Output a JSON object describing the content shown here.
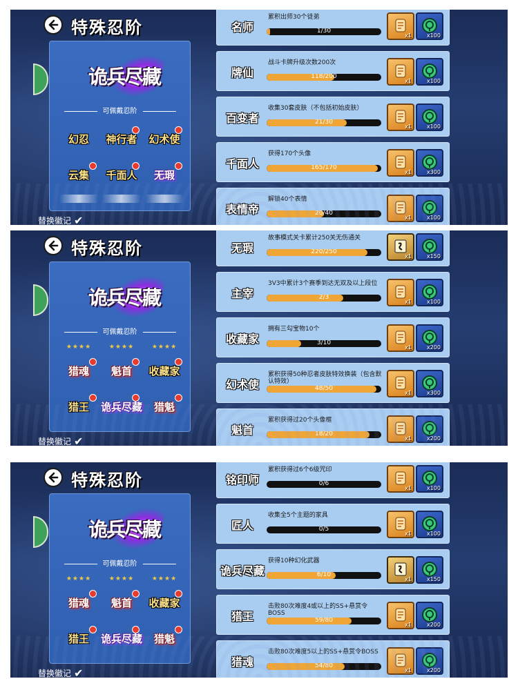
{
  "header": {
    "title": "特殊忍阶"
  },
  "left_card": {
    "selected_title": "诡兵尽藏",
    "wearable_label": "可佩戴忍阶",
    "replace_label": "替换徽记"
  },
  "panels": [
    {
      "badges_rows": [
        [
          {
            "text": "幻忍",
            "style": "gold",
            "dot": false
          },
          {
            "text": "神行者",
            "style": "gold",
            "dot": true
          },
          {
            "text": "幻术使",
            "style": "gold",
            "dot": true
          }
        ],
        [
          {
            "text": "云集",
            "style": "gold",
            "dot": true
          },
          {
            "text": "千面人",
            "style": "gold",
            "dot": true
          },
          {
            "text": "无瑕",
            "style": "purple",
            "dot": true
          }
        ]
      ],
      "partial_top": false,
      "partial_bottom": true,
      "achievements": [
        {
          "badge": "名师",
          "desc": "累积出师30个徒弟",
          "progress": "1/30",
          "pct": 0.033,
          "reward1": {
            "type": "scroll",
            "qty": "x1"
          },
          "reward2": {
            "type": "coin",
            "qty": "x100"
          }
        },
        {
          "badge": "牌仙",
          "desc": "战斗卡牌升级次数200次",
          "progress": "118/200",
          "pct": 0.59,
          "reward1": {
            "type": "scroll",
            "qty": "x1"
          },
          "reward2": {
            "type": "coin",
            "qty": "x100"
          }
        },
        {
          "badge": "百变者",
          "desc": "收集30套皮肤（不包括初始皮肤）",
          "progress": "21/30",
          "pct": 0.7,
          "reward1": {
            "type": "scroll",
            "qty": "x1"
          },
          "reward2": {
            "type": "coin",
            "qty": "x100"
          }
        },
        {
          "badge": "千面人",
          "desc": "获得170个头像",
          "progress": "165/170",
          "pct": 0.97,
          "reward1": {
            "type": "scroll",
            "qty": "x1"
          },
          "reward2": {
            "type": "coin",
            "qty": "x300"
          }
        },
        {
          "badge": "表情帝",
          "desc": "解锁40个表情",
          "progress": "20/40",
          "pct": 0.5,
          "reward1": {
            "type": "scroll",
            "qty": "x1"
          },
          "reward2": {
            "type": "coin",
            "qty": "x100"
          }
        }
      ]
    },
    {
      "badges_rows": [
        [
          {
            "text": "猎魂",
            "style": "red",
            "dot": true
          },
          {
            "text": "魁首",
            "style": "red",
            "dot": true
          },
          {
            "text": "收藏家",
            "style": "gold",
            "dot": true
          }
        ],
        [
          {
            "text": "猎王",
            "style": "gold",
            "dot": true
          },
          {
            "text": "诡兵尽藏",
            "style": "purple",
            "dot": true
          },
          {
            "text": "猎魁",
            "style": "red",
            "dot": true
          }
        ]
      ],
      "partial_top": true,
      "partial_bottom": false,
      "achievements": [
        {
          "badge": "无瑕",
          "desc": "故事模式关卡累计250关无伤通关",
          "progress": "220/250",
          "pct": 0.88,
          "reward1": {
            "type": "card",
            "qty": "x1"
          },
          "reward2": {
            "type": "coin",
            "qty": "x150"
          }
        },
        {
          "badge": "主宰",
          "desc": "3V3中累计3个赛季到达无双及以上段位",
          "progress": "2/3",
          "pct": 0.67,
          "reward1": {
            "type": "scroll",
            "qty": "x1"
          },
          "reward2": {
            "type": "coin",
            "qty": "x100"
          }
        },
        {
          "badge": "收藏家",
          "desc": "拥有三勾宝物10个",
          "progress": "3/10",
          "pct": 0.3,
          "reward1": {
            "type": "scroll",
            "qty": "x1"
          },
          "reward2": {
            "type": "coin",
            "qty": "x200"
          }
        },
        {
          "badge": "幻术使",
          "desc": "累积获得50种忍者皮肤特效换装（包含默认特效）",
          "progress": "48/50",
          "pct": 0.96,
          "reward1": {
            "type": "scroll",
            "qty": "x1"
          },
          "reward2": {
            "type": "coin",
            "qty": "x300"
          }
        },
        {
          "badge": "魁首",
          "desc": "累积获得过20个头像框",
          "progress": "18/20",
          "pct": 0.9,
          "reward1": {
            "type": "scroll",
            "qty": "x1"
          },
          "reward2": {
            "type": "coin",
            "qty": "x200"
          }
        }
      ]
    },
    {
      "badges_rows": [
        [
          {
            "text": "猎魂",
            "style": "red",
            "dot": true
          },
          {
            "text": "魁首",
            "style": "red",
            "dot": true
          },
          {
            "text": "收藏家",
            "style": "gold",
            "dot": true
          }
        ],
        [
          {
            "text": "猎王",
            "style": "gold",
            "dot": true
          },
          {
            "text": "诡兵尽藏",
            "style": "purple",
            "dot": true
          },
          {
            "text": "猎魁",
            "style": "red",
            "dot": true
          }
        ]
      ],
      "partial_top": true,
      "partial_bottom": false,
      "achievements": [
        {
          "badge": "铭印师",
          "desc": "累积获得过6个6级咒印",
          "progress": "0/6",
          "pct": 0,
          "reward1": {
            "type": "scroll",
            "qty": "x1"
          },
          "reward2": {
            "type": "coin",
            "qty": "x100"
          }
        },
        {
          "badge": "匠人",
          "desc": "收集全5个主题的家具",
          "progress": "0/5",
          "pct": 0,
          "reward1": {
            "type": "scroll",
            "qty": "x1"
          },
          "reward2": {
            "type": "coin",
            "qty": "x100"
          }
        },
        {
          "badge": "诡兵尽藏",
          "desc": "获得10种幻化武器",
          "progress": "6/10",
          "pct": 0.6,
          "reward1": {
            "type": "card",
            "qty": "x1"
          },
          "reward2": {
            "type": "coin",
            "qty": "x150"
          }
        },
        {
          "badge": "猎王",
          "desc": "击败80次难度4或以上的SS+悬赏令BOSS",
          "progress": "59/80",
          "pct": 0.74,
          "reward1": {
            "type": "scroll",
            "qty": "x1"
          },
          "reward2": {
            "type": "coin",
            "qty": "x200"
          }
        },
        {
          "badge": "猎魂",
          "desc": "击败80次难度5以上的SS+悬赏令BOSS",
          "progress": "54/80",
          "pct": 0.68,
          "reward1": {
            "type": "scroll",
            "qty": "x1"
          },
          "reward2": {
            "type": "coin",
            "qty": "x200"
          }
        }
      ]
    }
  ],
  "colors": {
    "progress_fill": "#f0a636",
    "card_bg": "#a9ccf1",
    "panel_bg": "#1f3463"
  },
  "icons": {
    "back": "arrow-left-icon",
    "check": "checkmark-icon",
    "reward_scroll": "scroll-icon",
    "reward_coin": "spirit-coin-icon",
    "reward_card": "card-icon"
  }
}
